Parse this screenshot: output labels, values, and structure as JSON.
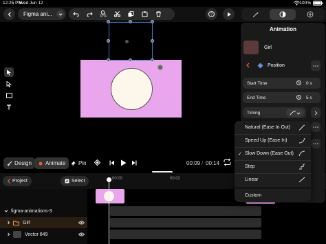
{
  "status_bar": {
    "time": "12:25 PM",
    "date": "Wed Jun 12",
    "battery": "100%"
  },
  "toolbar": {
    "document_name": "Figma ani...",
    "zoom": "37%"
  },
  "tools_panel_tabs": [
    "animate-tab",
    "design-tab",
    "prototype-tab"
  ],
  "canvas": {
    "artboard_color": "#eaa6ec",
    "circle_color": "#fdf6ea",
    "selection_color": "#3b79c9"
  },
  "mode_bar": {
    "design_label": "Design",
    "animate_label": "Animate",
    "pin_label": "Pin",
    "current_time": "00:09",
    "total_time": "00:14"
  },
  "timeline": {
    "project_label": "Project",
    "select_label": "Select",
    "ruler": [
      "00:00",
      "00:02"
    ],
    "layers": [
      {
        "name": "figma-animations-3"
      },
      {
        "name": "Girl"
      },
      {
        "name": "Vector 849"
      }
    ]
  },
  "animation_panel": {
    "title": "Animation",
    "layer_name": "Girl",
    "property": "Position",
    "start_time_label": "Start Time",
    "start_time_value": "0 s",
    "end_time_label": "End Time",
    "end_time_value": "5 s",
    "timing_label": "Timing"
  },
  "timing_menu": {
    "items": [
      {
        "label": "Natural (Ease In Out)",
        "checked": false
      },
      {
        "label": "Speed Up (Ease In)",
        "checked": false
      },
      {
        "label": "Slow Down (Ease Out)",
        "checked": true
      },
      {
        "label": "Step",
        "checked": false
      },
      {
        "label": "Linear",
        "checked": false
      },
      {
        "label": "Custom",
        "checked": false
      }
    ],
    "check_glyph": "✓"
  },
  "colors": {
    "accent_blue": "#3b79c9",
    "panel_bg": "#1a1a1a",
    "menu_bg": "#1e1e1e",
    "track_pink": "#eaa6ec"
  }
}
